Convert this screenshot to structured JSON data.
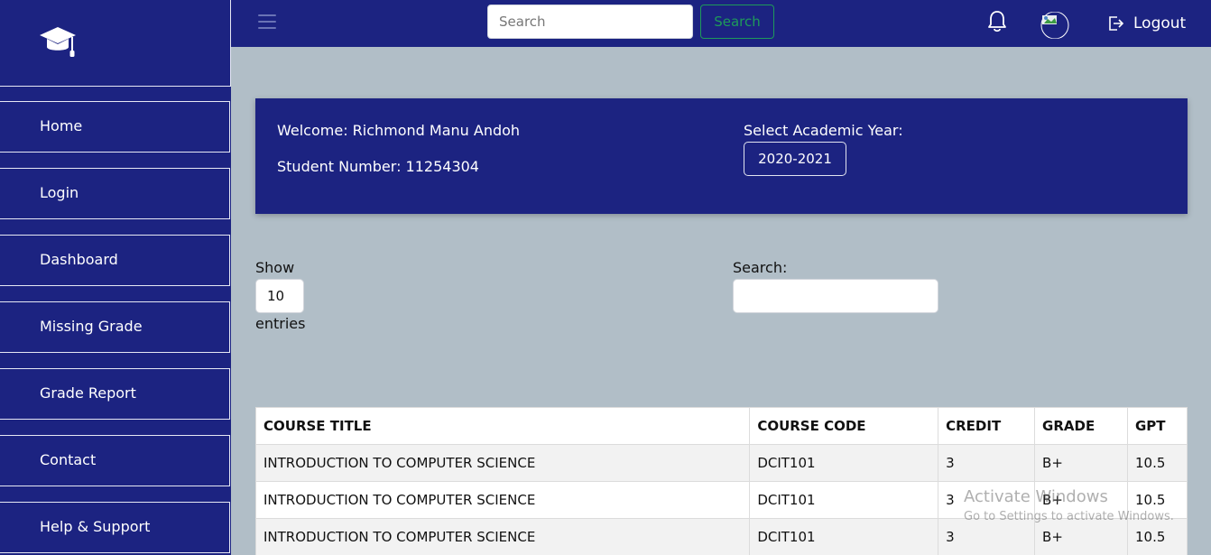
{
  "sidebar": {
    "items": [
      {
        "label": "Home"
      },
      {
        "label": "Login"
      },
      {
        "label": "Dashboard"
      },
      {
        "label": "Missing Grade"
      },
      {
        "label": "Grade Report"
      },
      {
        "label": "Contact"
      },
      {
        "label": "Help & Support"
      }
    ]
  },
  "topbar": {
    "search_placeholder": "Search",
    "search_button": "Search",
    "logout_label": "Logout"
  },
  "welcome": {
    "welcome_text": "Welcome: Richmond Manu Andoh",
    "student_number_text": "Student Number: 11254304",
    "year_label": "Select Academic Year:",
    "year_value": "2020-2021"
  },
  "table_controls": {
    "show_label": "Show",
    "show_value": "10",
    "entries_label": "entries",
    "search_label": "Search:"
  },
  "table": {
    "headers": [
      "COURSE TITLE",
      "COURSE CODE",
      "CREDIT",
      "GRADE",
      "GPT"
    ],
    "rows": [
      [
        "INTRODUCTION TO COMPUTER SCIENCE",
        "DCIT101",
        "3",
        "B+",
        "10.5"
      ],
      [
        "INTRODUCTION TO COMPUTER SCIENCE",
        "DCIT101",
        "3",
        "B+",
        "10.5"
      ],
      [
        "INTRODUCTION TO COMPUTER SCIENCE",
        "DCIT101",
        "3",
        "B+",
        "10.5"
      ]
    ]
  },
  "watermark": {
    "title": "Activate Windows",
    "subtitle": "Go to Settings to activate Windows."
  },
  "colors": {
    "brand_navy": "#1c2381",
    "page_background": "#b1bec7",
    "search_button_green": "#1e9a5a"
  },
  "icons": {
    "logo": "graduation-cap-icon",
    "menu": "hamburger-icon",
    "notifications": "bell-icon",
    "logout": "logout-icon"
  }
}
